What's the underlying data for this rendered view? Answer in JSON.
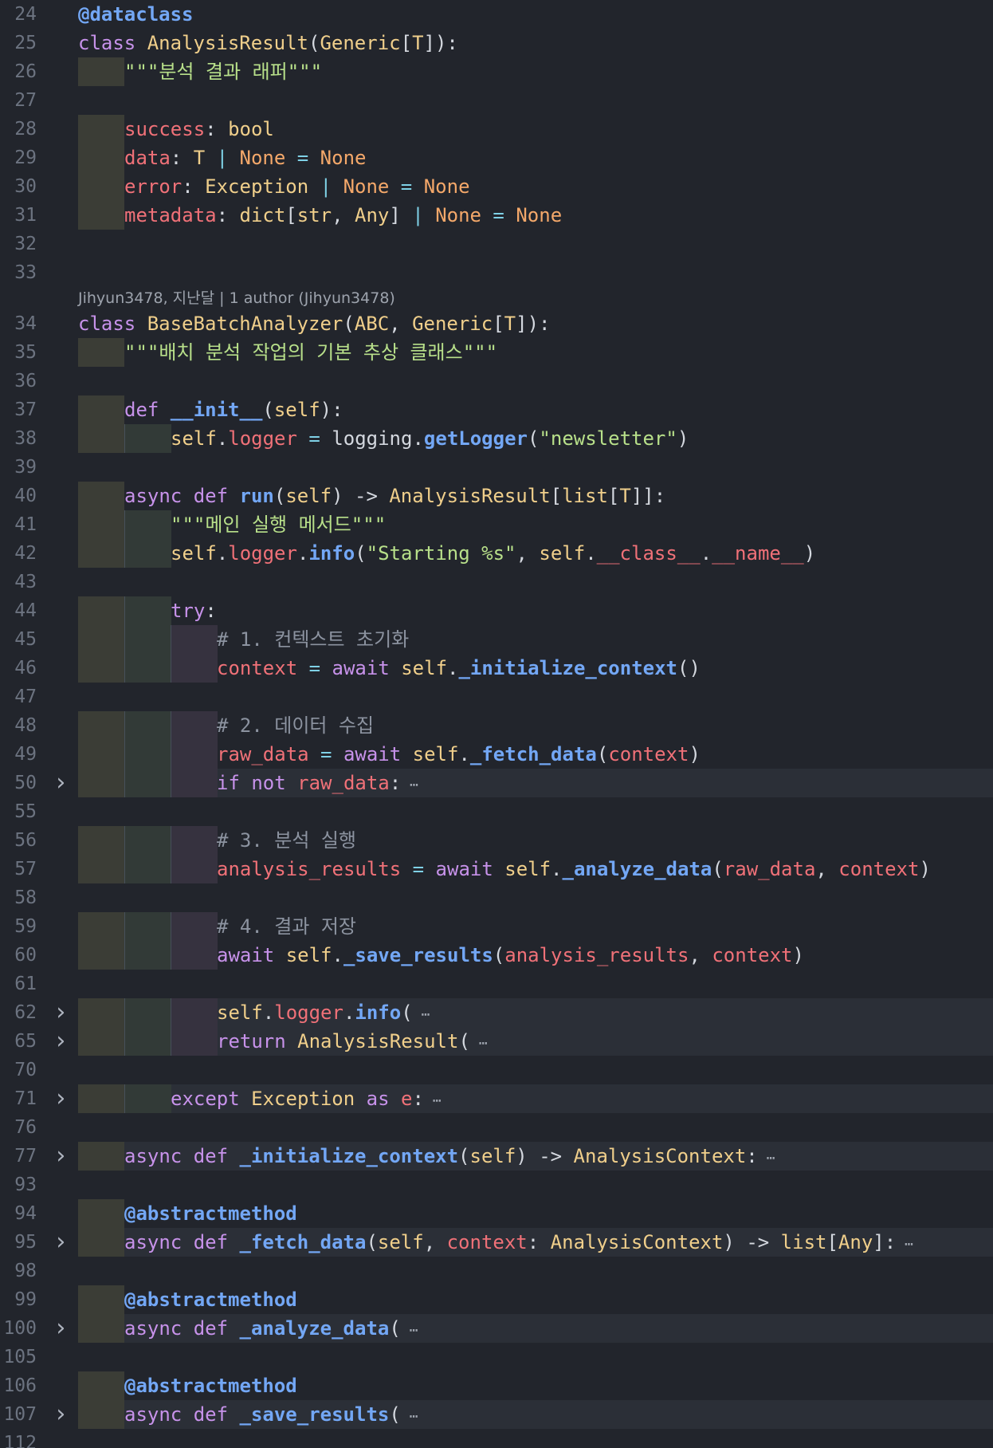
{
  "editor": {
    "language": "python",
    "blame_annotation": "Jihyun3478, 지난달 | 1 author (Jihyun3478)",
    "fold_icon": "chevron-right-icon",
    "lines": [
      {
        "num": "24",
        "indent": 0,
        "tokens": [
          [
            "dec",
            "@dataclass"
          ]
        ]
      },
      {
        "num": "25",
        "indent": 0,
        "tokens": [
          [
            "kw",
            "class "
          ],
          [
            "cls",
            "AnalysisResult"
          ],
          [
            "punc",
            "("
          ],
          [
            "type",
            "Generic"
          ],
          [
            "punc",
            "["
          ],
          [
            "type",
            "T"
          ],
          [
            "punc",
            "]):"
          ]
        ]
      },
      {
        "num": "26",
        "indent": 1,
        "tokens": [
          [
            "doc",
            "\"\"\"분석 결과 래퍼\"\"\""
          ]
        ]
      },
      {
        "num": "27",
        "indent": 0,
        "tokens": []
      },
      {
        "num": "28",
        "indent": 1,
        "tokens": [
          [
            "prop",
            "success"
          ],
          [
            "punc",
            ": "
          ],
          [
            "type",
            "bool"
          ]
        ]
      },
      {
        "num": "29",
        "indent": 1,
        "tokens": [
          [
            "prop",
            "data"
          ],
          [
            "punc",
            ": "
          ],
          [
            "type",
            "T"
          ],
          [
            "op",
            " | "
          ],
          [
            "none",
            "None"
          ],
          [
            "op",
            " = "
          ],
          [
            "none",
            "None"
          ]
        ]
      },
      {
        "num": "30",
        "indent": 1,
        "tokens": [
          [
            "prop",
            "error"
          ],
          [
            "punc",
            ": "
          ],
          [
            "type",
            "Exception"
          ],
          [
            "op",
            " | "
          ],
          [
            "none",
            "None"
          ],
          [
            "op",
            " = "
          ],
          [
            "none",
            "None"
          ]
        ]
      },
      {
        "num": "31",
        "indent": 1,
        "tokens": [
          [
            "prop",
            "metadata"
          ],
          [
            "punc",
            ": "
          ],
          [
            "type",
            "dict"
          ],
          [
            "punc",
            "["
          ],
          [
            "type",
            "str"
          ],
          [
            "punc",
            ", "
          ],
          [
            "type",
            "Any"
          ],
          [
            "punc",
            "]"
          ],
          [
            "op",
            " | "
          ],
          [
            "none",
            "None"
          ],
          [
            "op",
            " = "
          ],
          [
            "none",
            "None"
          ]
        ]
      },
      {
        "num": "32",
        "indent": 0,
        "tokens": []
      },
      {
        "num": "33",
        "indent": 0,
        "tokens": [],
        "blame_after": true
      },
      {
        "num": "34",
        "indent": 0,
        "tokens": [
          [
            "kw",
            "class "
          ],
          [
            "cls",
            "BaseBatchAnalyzer"
          ],
          [
            "punc",
            "("
          ],
          [
            "type",
            "ABC"
          ],
          [
            "punc",
            ", "
          ],
          [
            "type",
            "Generic"
          ],
          [
            "punc",
            "["
          ],
          [
            "type",
            "T"
          ],
          [
            "punc",
            "]):"
          ]
        ]
      },
      {
        "num": "35",
        "indent": 1,
        "tokens": [
          [
            "doc",
            "\"\"\"배치 분석 작업의 기본 추상 클래스\"\"\""
          ]
        ]
      },
      {
        "num": "36",
        "indent": 0,
        "tokens": []
      },
      {
        "num": "37",
        "indent": 1,
        "tokens": [
          [
            "kw",
            "def "
          ],
          [
            "fn",
            "__init__"
          ],
          [
            "punc",
            "("
          ],
          [
            "self",
            "self"
          ],
          [
            "punc",
            "):"
          ]
        ]
      },
      {
        "num": "38",
        "indent": 2,
        "tokens": [
          [
            "self",
            "self"
          ],
          [
            "punc",
            "."
          ],
          [
            "prop",
            "logger"
          ],
          [
            "op",
            " = "
          ],
          [
            "plain",
            "logging"
          ],
          [
            "punc",
            "."
          ],
          [
            "fn",
            "getLogger"
          ],
          [
            "punc",
            "("
          ],
          [
            "str",
            "\"newsletter\""
          ],
          [
            "punc",
            ")"
          ]
        ]
      },
      {
        "num": "39",
        "indent": 0,
        "tokens": []
      },
      {
        "num": "40",
        "indent": 1,
        "tokens": [
          [
            "kw",
            "async def "
          ],
          [
            "fn",
            "run"
          ],
          [
            "punc",
            "("
          ],
          [
            "self",
            "self"
          ],
          [
            "punc",
            ") -> "
          ],
          [
            "type",
            "AnalysisResult"
          ],
          [
            "punc",
            "["
          ],
          [
            "type",
            "list"
          ],
          [
            "punc",
            "["
          ],
          [
            "type",
            "T"
          ],
          [
            "punc",
            "]]:"
          ]
        ]
      },
      {
        "num": "41",
        "indent": 2,
        "tokens": [
          [
            "doc",
            "\"\"\"메인 실행 메서드\"\"\""
          ]
        ]
      },
      {
        "num": "42",
        "indent": 2,
        "tokens": [
          [
            "self",
            "self"
          ],
          [
            "punc",
            "."
          ],
          [
            "prop",
            "logger"
          ],
          [
            "punc",
            "."
          ],
          [
            "fn",
            "info"
          ],
          [
            "punc",
            "("
          ],
          [
            "str",
            "\"Starting %s\""
          ],
          [
            "punc",
            ", "
          ],
          [
            "self",
            "self"
          ],
          [
            "punc",
            "."
          ],
          [
            "prop",
            "__class__"
          ],
          [
            "punc",
            "."
          ],
          [
            "prop",
            "__name__"
          ],
          [
            "punc",
            ")"
          ]
        ]
      },
      {
        "num": "43",
        "indent": 0,
        "tokens": []
      },
      {
        "num": "44",
        "indent": 2,
        "tokens": [
          [
            "kw",
            "try"
          ],
          [
            "punc",
            ":"
          ]
        ]
      },
      {
        "num": "45",
        "indent": 3,
        "tokens": [
          [
            "com",
            "# 1. 컨텍스트 초기화"
          ]
        ]
      },
      {
        "num": "46",
        "indent": 3,
        "tokens": [
          [
            "var",
            "context"
          ],
          [
            "op",
            " = "
          ],
          [
            "kw",
            "await "
          ],
          [
            "self",
            "self"
          ],
          [
            "punc",
            "."
          ],
          [
            "fn",
            "_initialize_context"
          ],
          [
            "punc",
            "()"
          ]
        ]
      },
      {
        "num": "47",
        "indent": 0,
        "tokens": []
      },
      {
        "num": "48",
        "indent": 3,
        "tokens": [
          [
            "com",
            "# 2. 데이터 수집"
          ]
        ]
      },
      {
        "num": "49",
        "indent": 3,
        "tokens": [
          [
            "var",
            "raw_data"
          ],
          [
            "op",
            " = "
          ],
          [
            "kw",
            "await "
          ],
          [
            "self",
            "self"
          ],
          [
            "punc",
            "."
          ],
          [
            "fn",
            "_fetch_data"
          ],
          [
            "punc",
            "("
          ],
          [
            "var",
            "context"
          ],
          [
            "punc",
            ")"
          ]
        ]
      },
      {
        "num": "50",
        "indent": 3,
        "folded": true,
        "tokens": [
          [
            "kw",
            "if not "
          ],
          [
            "var",
            "raw_data"
          ],
          [
            "punc",
            ":"
          ],
          [
            "ell",
            " ⋯"
          ]
        ]
      },
      {
        "num": "55",
        "indent": 0,
        "tokens": []
      },
      {
        "num": "56",
        "indent": 3,
        "tokens": [
          [
            "com",
            "# 3. 분석 실행"
          ]
        ]
      },
      {
        "num": "57",
        "indent": 3,
        "tokens": [
          [
            "var",
            "analysis_results"
          ],
          [
            "op",
            " = "
          ],
          [
            "kw",
            "await "
          ],
          [
            "self",
            "self"
          ],
          [
            "punc",
            "."
          ],
          [
            "fn",
            "_analyze_data"
          ],
          [
            "punc",
            "("
          ],
          [
            "var",
            "raw_data"
          ],
          [
            "punc",
            ", "
          ],
          [
            "var",
            "context"
          ],
          [
            "punc",
            ")"
          ]
        ]
      },
      {
        "num": "58",
        "indent": 0,
        "tokens": []
      },
      {
        "num": "59",
        "indent": 3,
        "tokens": [
          [
            "com",
            "# 4. 결과 저장"
          ]
        ]
      },
      {
        "num": "60",
        "indent": 3,
        "tokens": [
          [
            "kw",
            "await "
          ],
          [
            "self",
            "self"
          ],
          [
            "punc",
            "."
          ],
          [
            "fn",
            "_save_results"
          ],
          [
            "punc",
            "("
          ],
          [
            "var",
            "analysis_results"
          ],
          [
            "punc",
            ", "
          ],
          [
            "var",
            "context"
          ],
          [
            "punc",
            ")"
          ]
        ]
      },
      {
        "num": "61",
        "indent": 0,
        "tokens": []
      },
      {
        "num": "62",
        "indent": 3,
        "folded": true,
        "tokens": [
          [
            "self",
            "self"
          ],
          [
            "punc",
            "."
          ],
          [
            "prop",
            "logger"
          ],
          [
            "punc",
            "."
          ],
          [
            "fn",
            "info"
          ],
          [
            "punc",
            "("
          ],
          [
            "ell",
            " ⋯"
          ]
        ]
      },
      {
        "num": "65",
        "indent": 3,
        "folded": true,
        "tokens": [
          [
            "kw",
            "return "
          ],
          [
            "type",
            "AnalysisResult"
          ],
          [
            "punc",
            "("
          ],
          [
            "ell",
            " ⋯"
          ]
        ]
      },
      {
        "num": "70",
        "indent": 0,
        "tokens": []
      },
      {
        "num": "71",
        "indent": 2,
        "folded": true,
        "tokens": [
          [
            "kw",
            "except "
          ],
          [
            "type",
            "Exception"
          ],
          [
            "kw",
            " as "
          ],
          [
            "var",
            "e"
          ],
          [
            "punc",
            ":"
          ],
          [
            "ell",
            " ⋯"
          ]
        ]
      },
      {
        "num": "76",
        "indent": 0,
        "tokens": []
      },
      {
        "num": "77",
        "indent": 1,
        "folded": true,
        "tokens": [
          [
            "kw",
            "async def "
          ],
          [
            "fn",
            "_initialize_context"
          ],
          [
            "punc",
            "("
          ],
          [
            "self",
            "self"
          ],
          [
            "punc",
            ") -> "
          ],
          [
            "type",
            "AnalysisContext"
          ],
          [
            "punc",
            ":"
          ],
          [
            "ell",
            " ⋯"
          ]
        ]
      },
      {
        "num": "93",
        "indent": 0,
        "tokens": []
      },
      {
        "num": "94",
        "indent": 1,
        "tokens": [
          [
            "dec",
            "@abstractmethod"
          ]
        ]
      },
      {
        "num": "95",
        "indent": 1,
        "folded": true,
        "tokens": [
          [
            "kw",
            "async def "
          ],
          [
            "fn",
            "_fetch_data"
          ],
          [
            "punc",
            "("
          ],
          [
            "self",
            "self"
          ],
          [
            "punc",
            ", "
          ],
          [
            "var",
            "context"
          ],
          [
            "punc",
            ": "
          ],
          [
            "type",
            "AnalysisContext"
          ],
          [
            "punc",
            ") -> "
          ],
          [
            "type",
            "list"
          ],
          [
            "punc",
            "["
          ],
          [
            "type",
            "Any"
          ],
          [
            "punc",
            "]:"
          ],
          [
            "ell",
            " ⋯"
          ]
        ]
      },
      {
        "num": "98",
        "indent": 0,
        "tokens": []
      },
      {
        "num": "99",
        "indent": 1,
        "tokens": [
          [
            "dec",
            "@abstractmethod"
          ]
        ]
      },
      {
        "num": "100",
        "indent": 1,
        "folded": true,
        "tokens": [
          [
            "kw",
            "async def "
          ],
          [
            "fn",
            "_analyze_data"
          ],
          [
            "punc",
            "("
          ],
          [
            "ell",
            " ⋯"
          ]
        ]
      },
      {
        "num": "105",
        "indent": 0,
        "tokens": []
      },
      {
        "num": "106",
        "indent": 1,
        "tokens": [
          [
            "dec",
            "@abstractmethod"
          ]
        ]
      },
      {
        "num": "107",
        "indent": 1,
        "folded": true,
        "tokens": [
          [
            "kw",
            "async def "
          ],
          [
            "fn",
            "_save_results"
          ],
          [
            "punc",
            "("
          ],
          [
            "ell",
            " ⋯"
          ]
        ]
      },
      {
        "num": "112",
        "indent": 0,
        "tokens": []
      }
    ]
  }
}
